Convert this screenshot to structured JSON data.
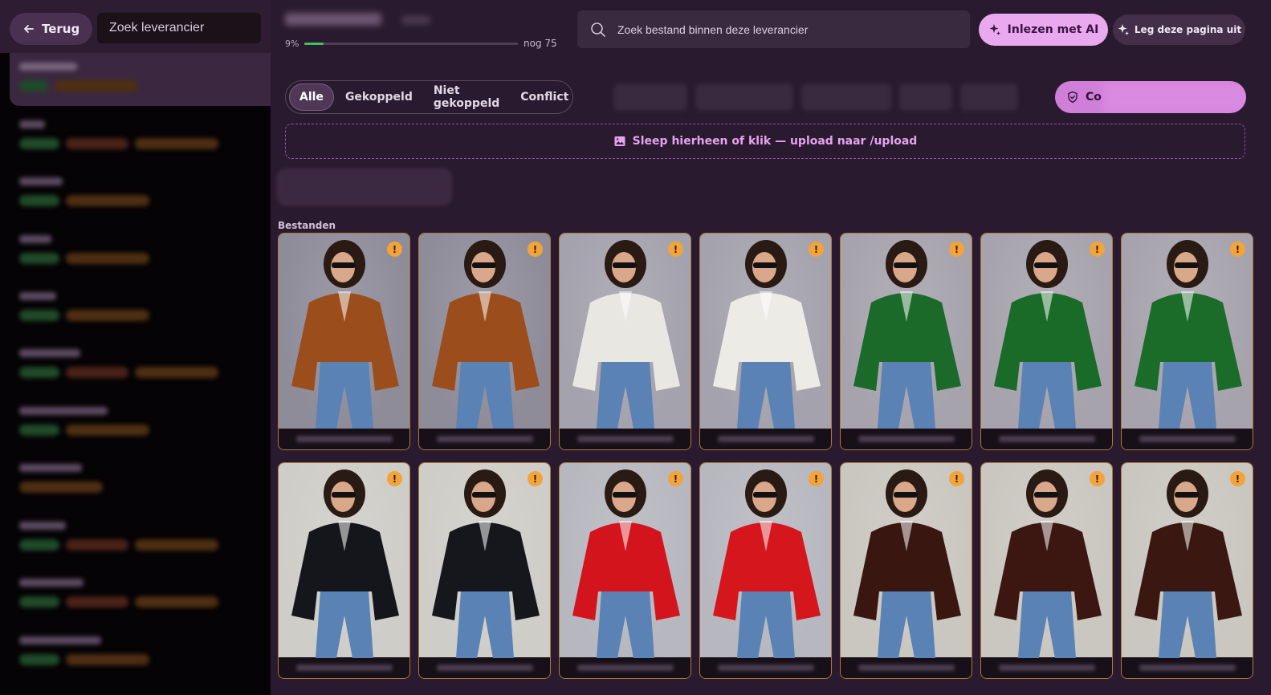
{
  "sidebar": {
    "back_label": "Terug",
    "search_placeholder": "Zoek leverancier"
  },
  "header": {
    "progress_text": "9%",
    "progress_fraction": 0.09,
    "progress_rest": "nog 75",
    "search_placeholder": "Zoek bestand binnen deze leverancier",
    "ai_button": "Inlezen met AI",
    "explain_button": "Leg deze pagina uit"
  },
  "filters": {
    "tabs": [
      "Alle",
      "Gekoppeld",
      "Niet gekoppeld",
      "Conflict"
    ],
    "active": 0
  },
  "control_button": "Co",
  "dropzone_text": "Sleep hierheen of klik — upload naar /upload",
  "section_label": "Bestanden",
  "warning_symbol": "!",
  "colors": {
    "accent": "#eaa9ef",
    "warning": "#f2a33a",
    "progress": "#3fbf5d",
    "card_border": "#b07a34"
  },
  "cards": [
    {
      "jacket": "brown-leather-jacket",
      "bg": "#8f8c9a",
      "color": "#9b4e1c"
    },
    {
      "jacket": "brown-leather-jacket-bucket-hat",
      "bg": "#8f8c9a",
      "color": "#9b4e1c"
    },
    {
      "jacket": "white-jacket",
      "bg": "#a4a3ad",
      "color": "#e9e7e2"
    },
    {
      "jacket": "white-jacket-front",
      "bg": "#a4a3ad",
      "color": "#ecebe6"
    },
    {
      "jacket": "green-vinyl-jacket",
      "bg": "#a6a3ad",
      "color": "#1c6a2a"
    },
    {
      "jacket": "green-vinyl-jacket-side",
      "bg": "#a6a3ad",
      "color": "#1a6a28"
    },
    {
      "jacket": "green-vinyl-jacket-pose",
      "bg": "#a6a3ad",
      "color": "#1b6c29"
    },
    {
      "jacket": "black-vinyl-jacket",
      "bg": "#cfcdc8",
      "color": "#14161c"
    },
    {
      "jacket": "black-vinyl-jacket-front",
      "bg": "#cfcdc8",
      "color": "#15171d"
    },
    {
      "jacket": "red-vinyl-jacket",
      "bg": "#b7b8bf",
      "color": "#d4141c"
    },
    {
      "jacket": "red-vinyl-jacket-bucket-hat",
      "bg": "#b7b8bf",
      "color": "#d6161d"
    },
    {
      "jacket": "dark-brown-leather-jacket",
      "bg": "#cac6c0",
      "color": "#3a1610"
    },
    {
      "jacket": "dark-brown-leather-jacket-side",
      "bg": "#cac6c0",
      "color": "#3c1712"
    },
    {
      "jacket": "dark-brown-leather-jacket-back",
      "bg": "#cac6c0",
      "color": "#3b1711"
    }
  ]
}
